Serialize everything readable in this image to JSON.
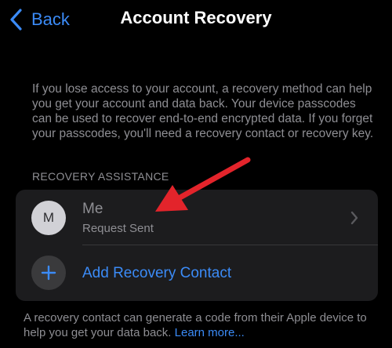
{
  "nav": {
    "back_label": "Back",
    "title": "Account Recovery"
  },
  "intro": {
    "text": "If you lose access to your account, a recovery method can help you get your account and data back. Your device passcodes can be used to recover end-to-end encrypted data. If you forget your passcodes, you'll need a recovery contact or recovery key."
  },
  "section": {
    "header": "RECOVERY ASSISTANCE"
  },
  "contacts": [
    {
      "initial": "M",
      "name": "Me",
      "status": "Request Sent"
    }
  ],
  "add_contact": {
    "label": "Add Recovery Contact"
  },
  "footer": {
    "text": "A recovery contact can generate a code from their Apple device to help you get your data back.",
    "link": "Learn more..."
  },
  "colors": {
    "accent": "#3b8bf7",
    "annotation_arrow": "#e3242b",
    "background": "#000000",
    "card": "#1c1c1e",
    "secondary_text": "#8e8e93"
  },
  "icons": {
    "back": "chevron-left-icon",
    "row_disclosure": "chevron-right-icon",
    "add": "plus-icon",
    "annotation": "red-arrow-icon"
  }
}
